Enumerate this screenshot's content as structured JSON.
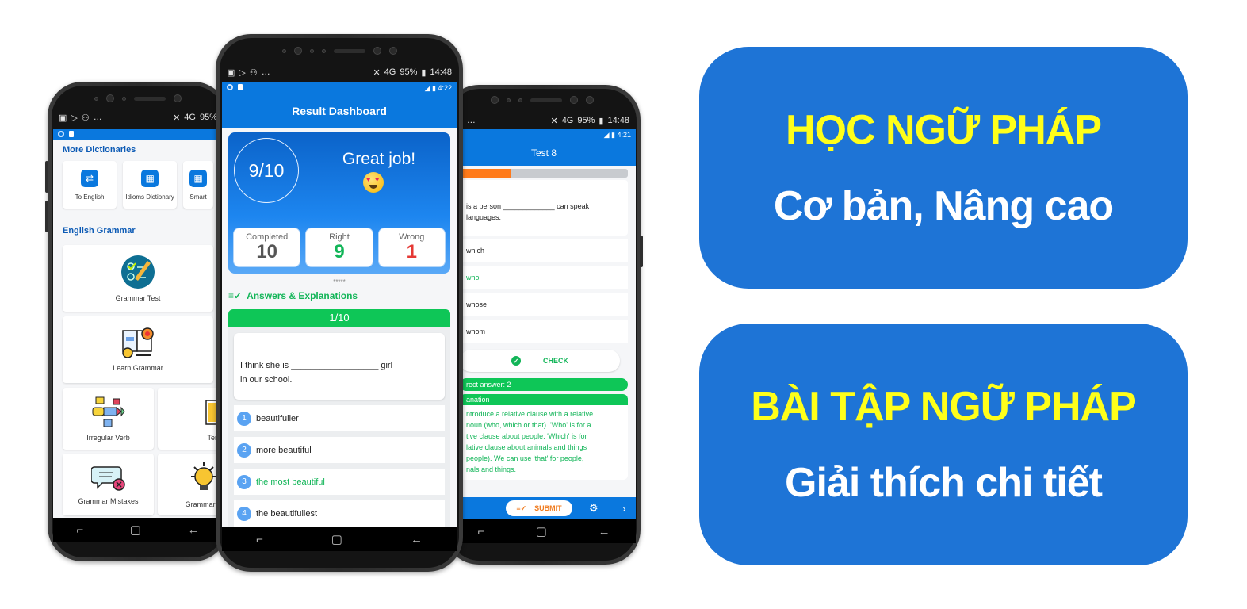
{
  "status_bar": {
    "left_icons": [
      "image-icon",
      "play-store-icon",
      "accessibility-icon",
      "more-icon"
    ],
    "signal": "4G",
    "battery": "95%",
    "time": "14:48"
  },
  "phone_left": {
    "app_status": {
      "left": "",
      "right": ""
    },
    "dictionaries": {
      "title": "More Dictionaries",
      "items": [
        {
          "label": "To English",
          "icon": "swap-arrows-icon"
        },
        {
          "label": "Idioms Dictionary",
          "icon": "grid-icon"
        },
        {
          "label": "Smart",
          "icon": "app-icon"
        }
      ]
    },
    "grammar": {
      "title": "English Grammar",
      "items": [
        {
          "label": "Grammar Test",
          "icon": "grammar-test-icon"
        },
        {
          "label": "Learn Grammar",
          "icon": "learn-grammar-icon"
        },
        {
          "label": "Irregular Verb",
          "icon": "irregular-verb-icon"
        },
        {
          "label": "Tense Summ",
          "icon": "tense-summary-icon"
        },
        {
          "label": "Grammar Mistakes",
          "icon": "grammar-mistakes-icon"
        },
        {
          "label": "Grammar T",
          "icon": "lightbulb-icon"
        }
      ]
    }
  },
  "phone_center": {
    "app_time": "4:22",
    "title": "Result Dashboard",
    "score": "9/10",
    "greeting": "Great job!",
    "stats": [
      {
        "label": "Completed",
        "value": "10",
        "color": "#555555"
      },
      {
        "label": "Right",
        "value": "9",
        "color": "#12b558"
      },
      {
        "label": "Wrong",
        "value": "1",
        "color": "#e53935"
      }
    ],
    "stars": "*****",
    "answers_title": "Answers & Explanations",
    "question_counter": "1/10",
    "question_line1": "I think she is __________________ girl",
    "question_line2": "in our school.",
    "options": [
      {
        "num": "1",
        "text": "beautifuller",
        "correct": false
      },
      {
        "num": "2",
        "text": "more beautiful",
        "correct": false
      },
      {
        "num": "3",
        "text": "the most beautiful",
        "correct": true
      },
      {
        "num": "4",
        "text": "the beautifullest",
        "correct": false
      }
    ]
  },
  "phone_right": {
    "app_time": "4:21",
    "title": "Test 8",
    "progress": 0.3,
    "question_line1": "is a person _____________ can speak",
    "question_line2": "languages.",
    "options": [
      {
        "text": "which",
        "correct": false
      },
      {
        "text": "who",
        "correct": true
      },
      {
        "text": "whose",
        "correct": false
      },
      {
        "text": "whom",
        "correct": false
      }
    ],
    "check_label": "CHECK",
    "correct_answer": "rect answer: 2",
    "explanation_title": "anation",
    "explanation_lines": [
      "ntroduce a relative clause with a relative",
      "noun (who, which or that). 'Who' is for a",
      "tive clause about people. 'Which' is for",
      "lative clause about animals and things",
      " people). We can use 'that' for people,",
      "nals and things."
    ],
    "submit_label": "SUBMIT"
  },
  "promo": [
    {
      "headline": "HỌC NGỮ PHÁP",
      "subline": "Cơ bản, Nâng cao"
    },
    {
      "headline": "BÀI TẬP NGỮ PHÁP",
      "subline": "Giải thích chi tiết"
    }
  ],
  "colors": {
    "app_blue": "#0a78de",
    "promo_blue": "#1e74d6",
    "headline_yellow": "#ffff1a",
    "correct_green": "#12b558",
    "accent_orange": "#f07b1e"
  }
}
